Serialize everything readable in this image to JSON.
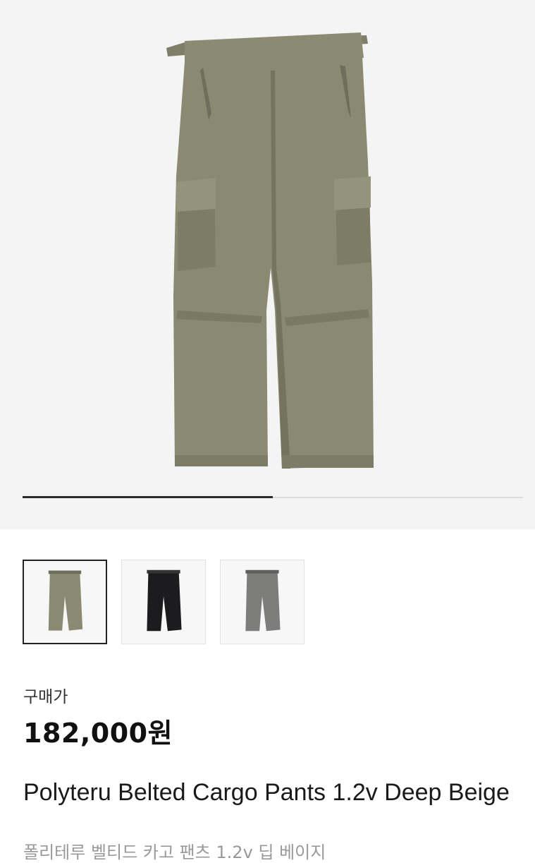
{
  "gallery": {
    "image_description_icon": "cargo-pants-photo",
    "slide_progress": 0.5
  },
  "colors": {
    "hero_bg": "#f4f4f4",
    "pants_deep_beige": "#8a8a72",
    "pants_black": "#1c1c1e",
    "pants_gray": "#7d7d7b",
    "accent_text": "#111111"
  },
  "thumbnails": [
    {
      "variant": "deep-beige",
      "selected": true
    },
    {
      "variant": "black",
      "selected": false
    },
    {
      "variant": "gray",
      "selected": false
    }
  ],
  "price": {
    "label": "구매가",
    "value": "182,000원"
  },
  "product": {
    "name": "Polyteru Belted Cargo Pants 1.2v Deep Beige",
    "subtitle": "폴리테루 벨티드 카고 팬츠 1.2v 딥 베이지"
  }
}
